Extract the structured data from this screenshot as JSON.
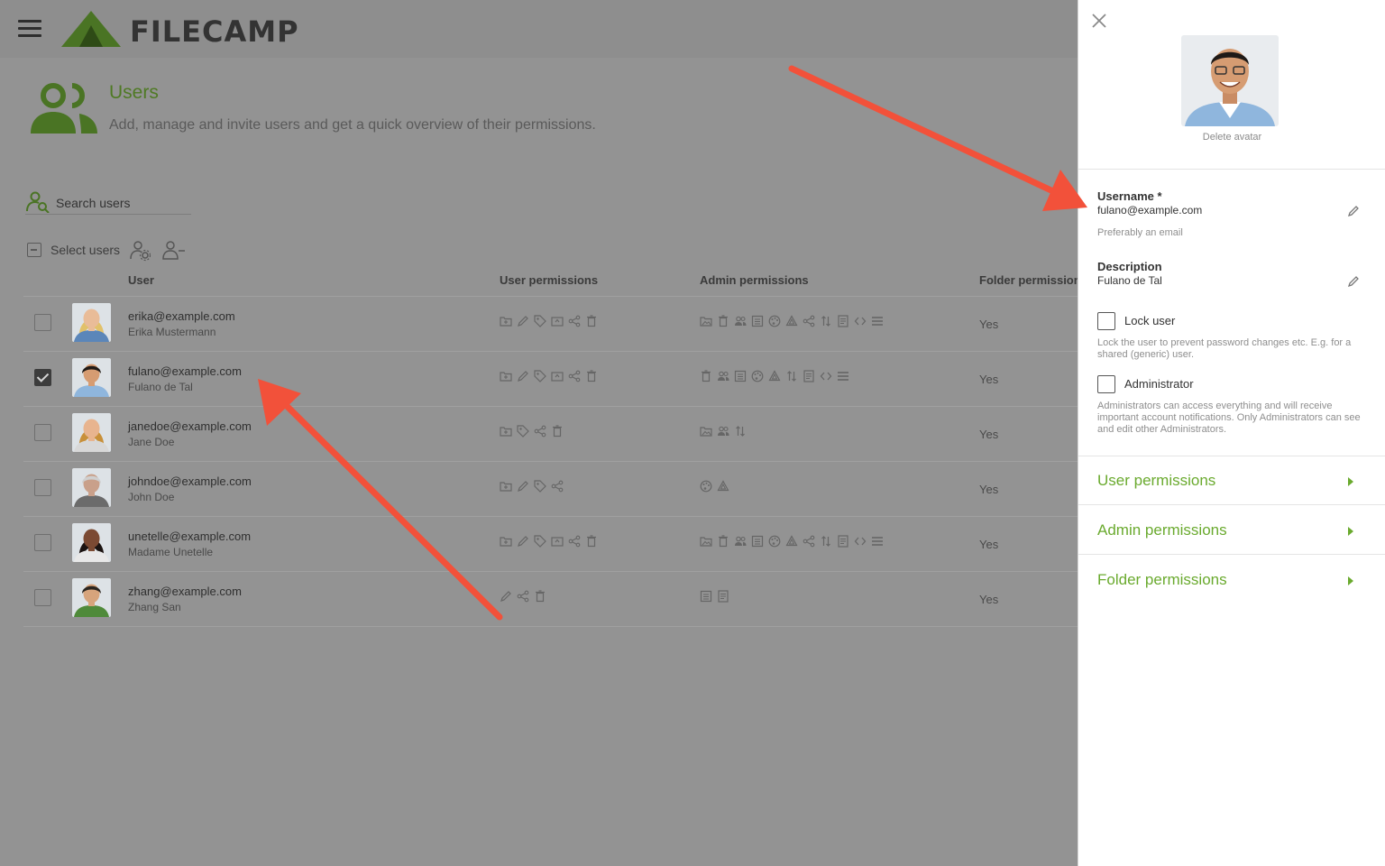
{
  "header": {
    "logo_text": "FILECAMP"
  },
  "page": {
    "title": "Users",
    "subtitle": "Add, manage and invite users and get a quick overview of their permissions."
  },
  "search": {
    "placeholder": "Search users"
  },
  "select": {
    "label": "Select users"
  },
  "table": {
    "columns": [
      "User",
      "User permissions",
      "Admin permissions",
      "Folder permissions"
    ],
    "rows": [
      {
        "email": "erika@example.com",
        "description": "Erika Mustermann",
        "checked": false,
        "folder": "Yes",
        "user_perms": [
          "folder-add-icon",
          "edit-icon",
          "tag-icon",
          "upload-icon",
          "share-icon",
          "trash-icon"
        ],
        "admin_perms": [
          "image-folder-icon",
          "trash-icon",
          "users-icon",
          "list-icon",
          "palette-icon",
          "recycle-icon",
          "share-icon",
          "sort-icon",
          "document-icon",
          "code-icon",
          "menu-icon"
        ]
      },
      {
        "email": "fulano@example.com",
        "description": "Fulano de Tal",
        "checked": true,
        "folder": "Yes",
        "user_perms": [
          "folder-add-icon",
          "edit-icon",
          "tag-icon",
          "upload-icon",
          "share-icon",
          "trash-icon"
        ],
        "admin_perms": [
          "trash-icon",
          "users-icon",
          "list-icon",
          "palette-icon",
          "recycle-icon",
          "sort-icon",
          "document-icon",
          "code-icon",
          "menu-icon"
        ]
      },
      {
        "email": "janedoe@example.com",
        "description": "Jane Doe",
        "checked": false,
        "folder": "Yes",
        "user_perms": [
          "folder-add-icon",
          "tag-icon",
          "share-icon",
          "trash-icon"
        ],
        "admin_perms": [
          "image-folder-icon",
          "users-icon",
          "sort-icon"
        ]
      },
      {
        "email": "johndoe@example.com",
        "description": "John Doe",
        "checked": false,
        "folder": "Yes",
        "user_perms": [
          "folder-add-icon",
          "edit-icon",
          "tag-icon",
          "share-icon"
        ],
        "admin_perms": [
          "palette-icon",
          "recycle-icon"
        ]
      },
      {
        "email": "unetelle@example.com",
        "description": "Madame Unetelle",
        "checked": false,
        "folder": "Yes",
        "user_perms": [
          "folder-add-icon",
          "edit-icon",
          "tag-icon",
          "upload-icon",
          "share-icon",
          "trash-icon"
        ],
        "admin_perms": [
          "image-folder-icon",
          "trash-icon",
          "users-icon",
          "list-icon",
          "palette-icon",
          "recycle-icon",
          "share-icon",
          "sort-icon",
          "document-icon",
          "code-icon",
          "menu-icon"
        ]
      },
      {
        "email": "zhang@example.com",
        "description": "Zhang San",
        "checked": false,
        "folder": "Yes",
        "user_perms": [
          "edit-icon",
          "share-icon",
          "trash-icon"
        ],
        "admin_perms": [
          "list-icon",
          "document-icon"
        ]
      }
    ]
  },
  "panel": {
    "delete_avatar": "Delete avatar",
    "username": {
      "label": "Username *",
      "value": "fulano@example.com",
      "hint": "Preferably an email"
    },
    "description": {
      "label": "Description",
      "value": "Fulano de Tal"
    },
    "lock": {
      "label": "Lock user",
      "help": "Lock the user to prevent password changes etc. E.g. for a shared (generic) user."
    },
    "admin": {
      "label": "Administrator",
      "help": "Administrators can access everything and will receive important account notifications. Only Administrators can see and edit other Administrators."
    },
    "sections": [
      "User permissions",
      "Admin permissions",
      "Folder permissions"
    ]
  },
  "colors": {
    "accent": "#6aaa2e",
    "dim_overlay": "#939393",
    "annotation": "#f2513a"
  }
}
